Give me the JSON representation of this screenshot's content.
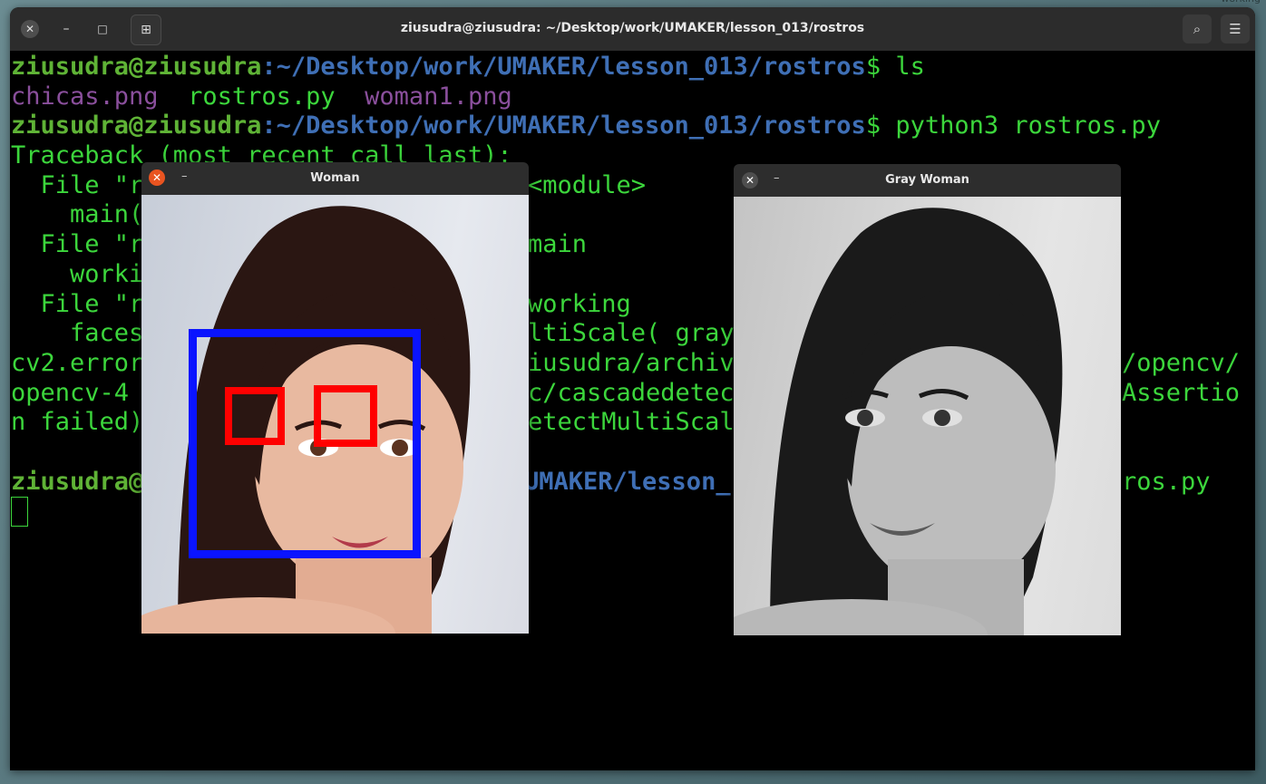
{
  "desktop": {
    "corner_label": "working"
  },
  "terminal": {
    "title": "ziusudra@ziusudra: ~/Desktop/work/UMAKER/lesson_013/rostros",
    "prompt_user": "ziusudra@ziusudra",
    "prompt_path": ":~/Desktop/work/UMAKER/lesson_013/rostros",
    "prompt_sym": "$",
    "cmd1": " ls",
    "ls_files": [
      "chicas.png",
      "rostros.py",
      "woman1.png"
    ],
    "cmd2": " python3 rostros.py",
    "output": {
      "traceback": "Traceback (most recent call last):",
      "l1_left": "  File \"r",
      "l1_right": "<module>",
      "l2_left": "    main(",
      "l3_left": "  File \"r",
      "l3_right": "main",
      "l4_left": "    worki",
      "l5_left": "  File \"r",
      "l5_right": "working",
      "l6_left": "    faces",
      "l6_right": "ltiScale( gray",
      "l7_left": "cv2.error",
      "l7_mid": "iusudra/archiv",
      "l7_right": "/opencv/",
      "l8_left": "opencv-4",
      "l8_mid": "c/cascadedetec",
      "l8_right": "Assertio",
      "l9_left": "n failed)",
      "l9_mid": "etectMultiScal",
      "l10_mid": "UMAKER/lesson_",
      "l10_right": "ros.py",
      "l10_left": "ziusudra@"
    }
  },
  "windows": {
    "woman": {
      "title": "Woman"
    },
    "gray": {
      "title": "Gray Woman"
    }
  },
  "colors": {
    "face_box": "#0a14ff",
    "eye_box": "#ff0000",
    "terminal_green": "#3cd63c",
    "path_blue": "#3f6fb5"
  }
}
